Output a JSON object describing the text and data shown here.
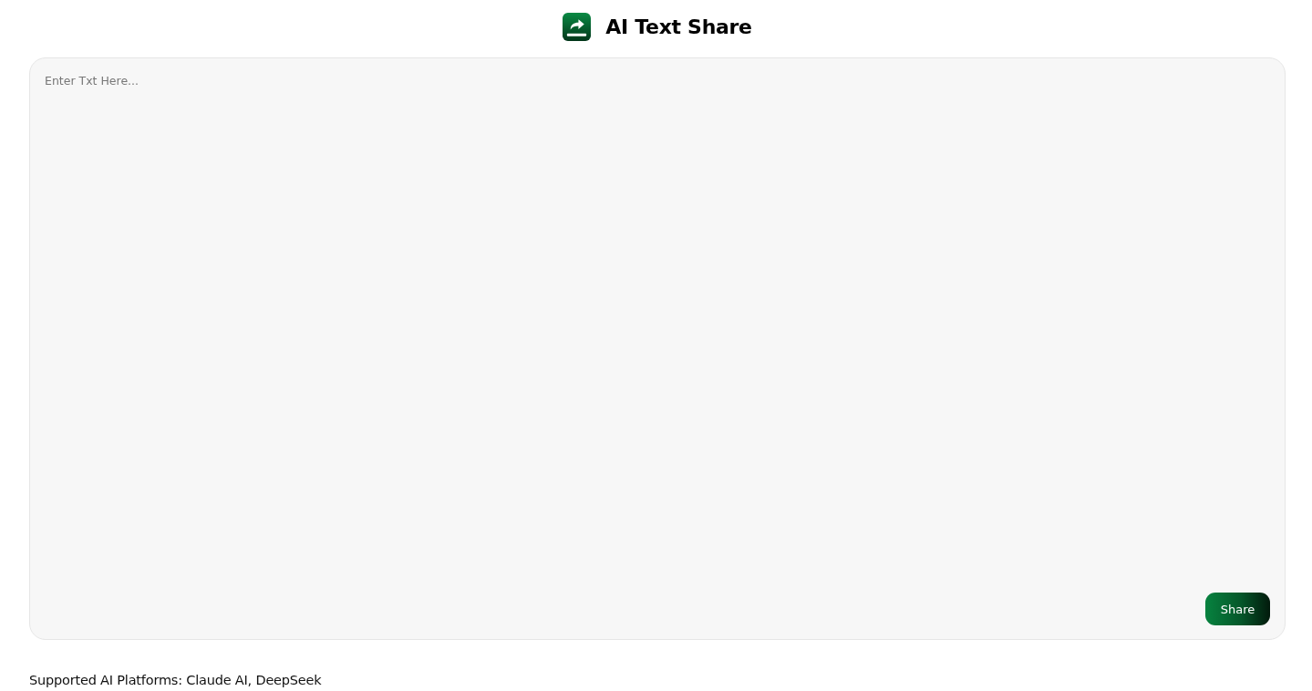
{
  "header": {
    "title": "AI Text Share"
  },
  "editor": {
    "placeholder": "Enter Txt Here...",
    "share_button": "Share"
  },
  "footer": {
    "text": "Supported AI Platforms: Claude AI, DeepSeek"
  }
}
